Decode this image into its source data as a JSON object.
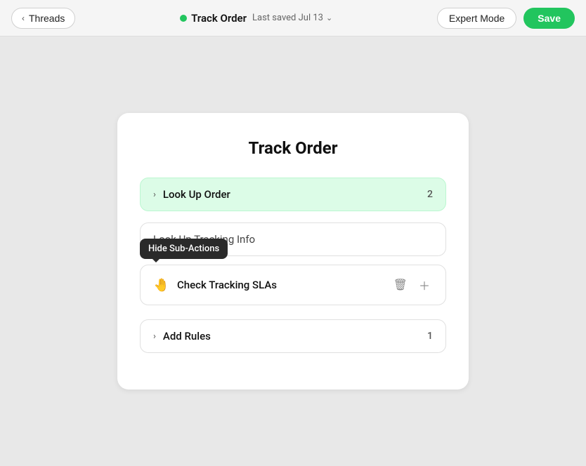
{
  "header": {
    "back_label": "Threads",
    "title": "Track Order",
    "status_dot": "green",
    "saved_label": "Last saved Jul 13",
    "expert_mode_label": "Expert Mode",
    "save_label": "Save"
  },
  "card": {
    "title": "Track Order",
    "rows": [
      {
        "id": "look-up-order",
        "label": "Look Up Order",
        "badge": "2",
        "has_chevron": true,
        "style": "green"
      },
      {
        "id": "look-up-tracking-info",
        "label": "Look Up Tracking Info",
        "badge": "",
        "has_chevron": false,
        "style": "tracking"
      },
      {
        "id": "check-tracking-slas",
        "label": "Check Tracking SLAs",
        "badge": "",
        "has_chevron": false,
        "style": "sub-action",
        "icon": "✋"
      },
      {
        "id": "add-rules",
        "label": "Add Rules",
        "badge": "1",
        "has_chevron": true,
        "style": "normal"
      }
    ],
    "tooltip": "Hide Sub-Actions"
  }
}
